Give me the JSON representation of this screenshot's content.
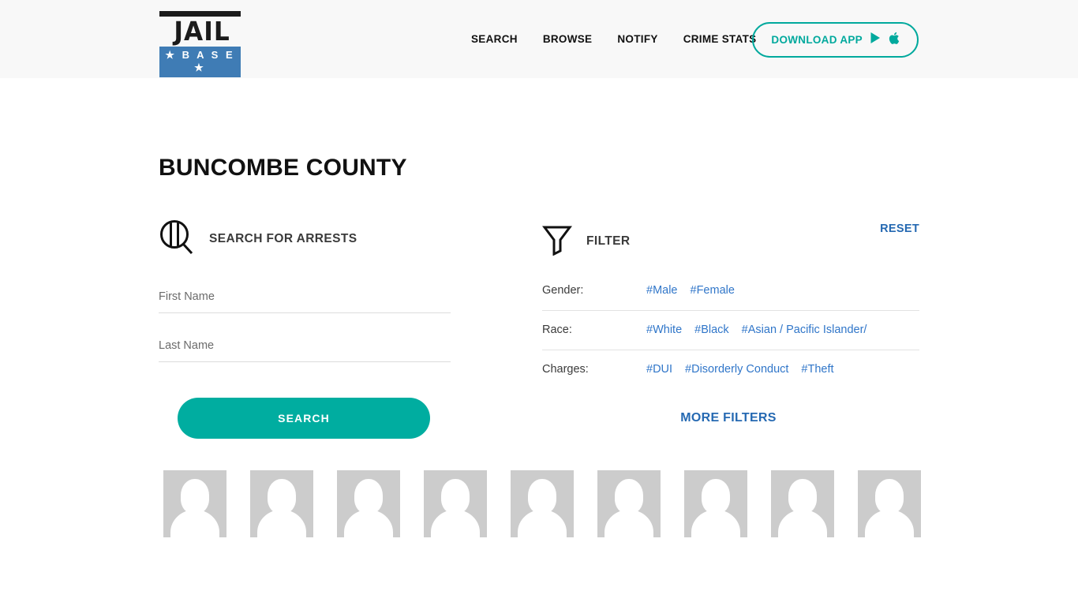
{
  "header": {
    "logo": {
      "top_text": "JAIL",
      "bottom_text": "★ B A S E ★"
    },
    "nav": [
      {
        "label": "SEARCH",
        "name": "nav-search"
      },
      {
        "label": "BROWSE",
        "name": "nav-browse"
      },
      {
        "label": "NOTIFY",
        "name": "nav-notify"
      },
      {
        "label": "CRIME STATS",
        "name": "nav-crime-stats"
      }
    ],
    "download_button": {
      "label": "DOWNLOAD APP",
      "icons": [
        "google-play-icon",
        "apple-icon"
      ]
    },
    "background_color": "#f8f8f8",
    "accent_color": "#00a99d"
  },
  "page": {
    "title": "BUNCOMBE COUNTY"
  },
  "search_panel": {
    "icon": "jail-magnifier-icon",
    "heading": "SEARCH FOR ARRESTS",
    "fields": [
      {
        "placeholder": "First Name",
        "value": "",
        "name": "first-name-input"
      },
      {
        "placeholder": "Last Name",
        "value": "",
        "name": "last-name-input"
      }
    ],
    "submit_label": "SEARCH",
    "submit_color": "#00ada0"
  },
  "filter_panel": {
    "icon": "funnel-icon",
    "heading": "FILTER",
    "reset_label": "RESET",
    "link_color": "#3076c9",
    "rows": [
      {
        "label": "Gender:",
        "tags": [
          "#Male",
          "#Female"
        ]
      },
      {
        "label": "Race:",
        "tags": [
          "#White",
          "#Black",
          "#Asian / Pacific Islander/"
        ]
      },
      {
        "label": "Charges:",
        "tags": [
          "#DUI",
          "#Disorderly Conduct",
          "#Theft"
        ]
      }
    ],
    "more_filters_label": "MORE FILTERS"
  },
  "mugshots": {
    "count": 9,
    "placeholder_name": "mugshot-placeholder"
  }
}
